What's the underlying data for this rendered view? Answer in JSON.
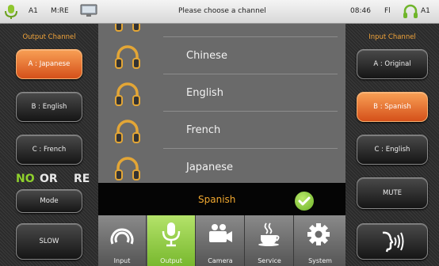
{
  "status": {
    "left_label": "A1",
    "mode_label": "M:RE",
    "title": "Please choose a channel",
    "time": "08:46",
    "fl": "Fl",
    "right_label": "A1"
  },
  "output": {
    "title": "Output  Channel",
    "buttons": [
      {
        "label": "A : Japanese",
        "active": true
      },
      {
        "label": "B : English",
        "active": false
      },
      {
        "label": "C : French",
        "active": false
      }
    ],
    "indicators": {
      "no": "NO",
      "or": "OR",
      "re": "RE"
    },
    "mode_label": "Mode",
    "slow_label": "SLOW"
  },
  "channels": [
    "Chinese",
    "English",
    "French",
    "Japanese"
  ],
  "selected": {
    "label": "Spanish"
  },
  "input": {
    "title": "Input  Channel",
    "buttons": [
      {
        "label": "A : Original",
        "active": false
      },
      {
        "label": "B : Spanish",
        "active": true
      },
      {
        "label": "C : English",
        "active": false
      }
    ],
    "mute_label": "MUTE"
  },
  "tabs": [
    {
      "label": "Input",
      "icon": "speaker-icon",
      "active": false
    },
    {
      "label": "Output",
      "icon": "microphone-icon",
      "active": true
    },
    {
      "label": "Camera",
      "icon": "camera-icon",
      "active": false
    },
    {
      "label": "Service",
      "icon": "coffee-cup-icon",
      "active": false
    },
    {
      "label": "System",
      "icon": "gear-icon",
      "active": false
    }
  ],
  "colors": {
    "accent_orange": "#e8691f",
    "accent_green": "#8fd12c",
    "list_bg": "#6a6a6a"
  }
}
